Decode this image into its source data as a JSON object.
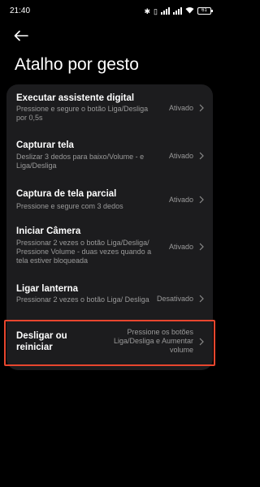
{
  "status_bar": {
    "time": "21:40",
    "battery": "61"
  },
  "header": {
    "title": "Atalho por gesto"
  },
  "settings": [
    {
      "title": "Executar assistente digital",
      "desc": "Pressione e segure o botão Liga/Desliga por 0,5s",
      "value": "Ativado"
    },
    {
      "title": "Capturar tela",
      "desc": "Deslizar 3 dedos para baixo/Volume - e Liga/Desliga",
      "value": "Ativado"
    },
    {
      "title": "Captura de tela parcial",
      "desc": "Pressione e segure com 3 dedos",
      "value": "Ativado"
    },
    {
      "title": "Iniciar Câmera",
      "desc": "Pressionar 2 vezes o botão Liga/Desliga/ Pressione Volume - duas vezes quando a tela estiver bloqueada",
      "value": "Ativado"
    },
    {
      "title": "Ligar lanterna",
      "desc": "Pressionar 2 vezes o botão Liga/ Desliga",
      "value": "Desativado"
    },
    {
      "title": "Desligar ou reiniciar",
      "desc": "",
      "value": "Pressione os botões Liga/Desliga e Aumentar volume"
    }
  ],
  "colors": {
    "background": "#000000",
    "card": "#1c1c1e",
    "secondary_text": "#9a9a9a",
    "highlight": "#e8462e"
  }
}
